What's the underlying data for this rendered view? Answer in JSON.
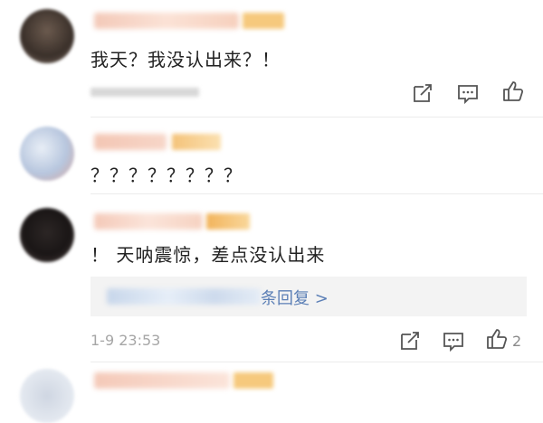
{
  "comments": [
    {
      "text": "我天？我没认出来？！",
      "likes": ""
    },
    {
      "text": "？？？？？？？？",
      "likes": ""
    },
    {
      "text": "！ 天呐震惊，差点没认出来",
      "reply_link": "条回复 >",
      "time": "1-9 23:53",
      "likes": "2"
    }
  ],
  "icons": [
    "share-icon",
    "comment-icon",
    "like-icon"
  ],
  "colors": {
    "text": "#222222",
    "meta": "#a6a6a6",
    "link": "#5b7fb6",
    "reply_bg": "#f3f3f3",
    "icon": "#555555"
  }
}
